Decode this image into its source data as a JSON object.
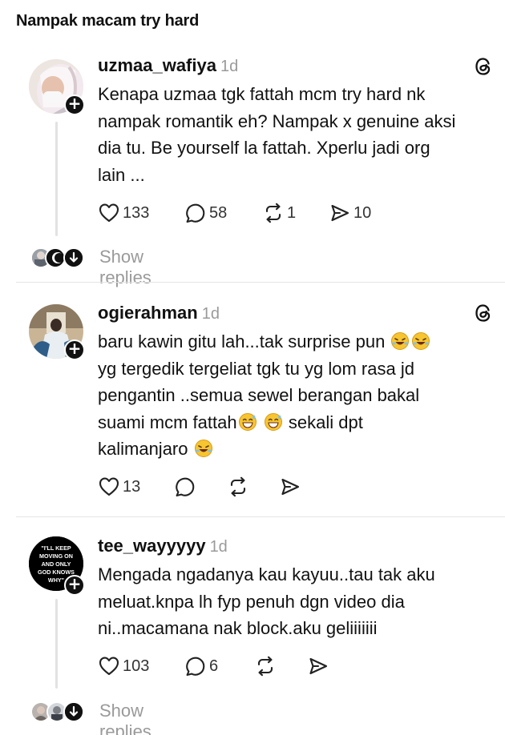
{
  "page": {
    "title": "Nampak macam try hard"
  },
  "posts": [
    {
      "username": "uzmaa_wafiya",
      "time": "1d",
      "lines": [
        "Kenapa uzmaa tgk fattah mcm try hard nk",
        "nampak romantik eh? Nampak x genuine aksi",
        "dia tu. Be yourself la fattah. Xperlu jadi org",
        "lain ..."
      ],
      "likes": "133",
      "comments": "58",
      "reposts": "1",
      "shares": "10",
      "show_replies": "Show replies"
    },
    {
      "username": "ogierahman",
      "time": "1d",
      "lines": [
        "baru kawin gitu lah...tak surprise pun",
        "yg tergedik tergeliat tgk tu yg lom rasa jd",
        "pengantin ..semua sewel berangan bakal",
        "suami mcm fattah",
        "sekali dpt",
        "kalimanjaro"
      ],
      "likes": "13"
    },
    {
      "username": "tee_wayyyyy",
      "time": "1d",
      "avatar_text": "\"I'LL KEEP MOVING ON AND ONLY GOD KNOWS WHY\"",
      "lines": [
        "Mengada ngadanya kau kayuu..tau tak aku",
        "meluat.knpa lh fyp penuh dgn video dia",
        "ni..macamana nak block.aku geliiiiiii"
      ],
      "likes": "103",
      "comments": "6",
      "show_replies": "Show replies"
    }
  ],
  "icons": {
    "heart": "heart-icon",
    "comment": "comment-icon",
    "repost": "repost-icon",
    "share": "share-icon",
    "threads": "threads-logo-icon",
    "follow": "plus-icon",
    "emoji_laugh": "rolling-laughing-emoji",
    "emoji_grin": "grinning-sweat-emoji"
  }
}
